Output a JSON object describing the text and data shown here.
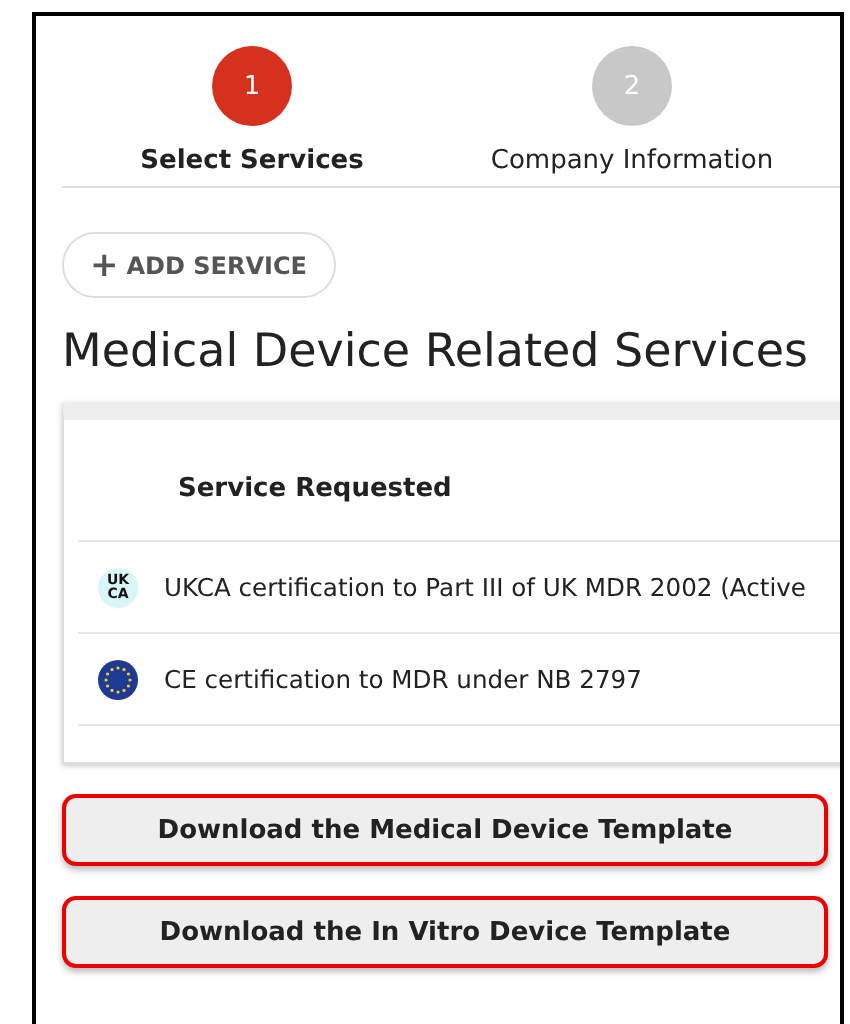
{
  "steps": [
    {
      "number": "1",
      "label": "Select Services",
      "selected": true
    },
    {
      "number": "2",
      "label": "Company Information",
      "selected": false
    }
  ],
  "add_button": {
    "icon": "+",
    "label": "ADD SERVICE"
  },
  "heading": "Medical Device Related Services",
  "table": {
    "columns": [
      "Service Requested"
    ],
    "rows": [
      {
        "mark": {
          "kind": "ukca",
          "lines": [
            "UK",
            "CA"
          ]
        },
        "text": "UKCA certification to Part III of UK MDR 2002 (Active"
      },
      {
        "mark": {
          "kind": "eu"
        },
        "text": "CE certification to MDR under NB 2797"
      }
    ]
  },
  "buttons": [
    "Download the Medical Device Template",
    "Download the In Vitro Device Template"
  ]
}
